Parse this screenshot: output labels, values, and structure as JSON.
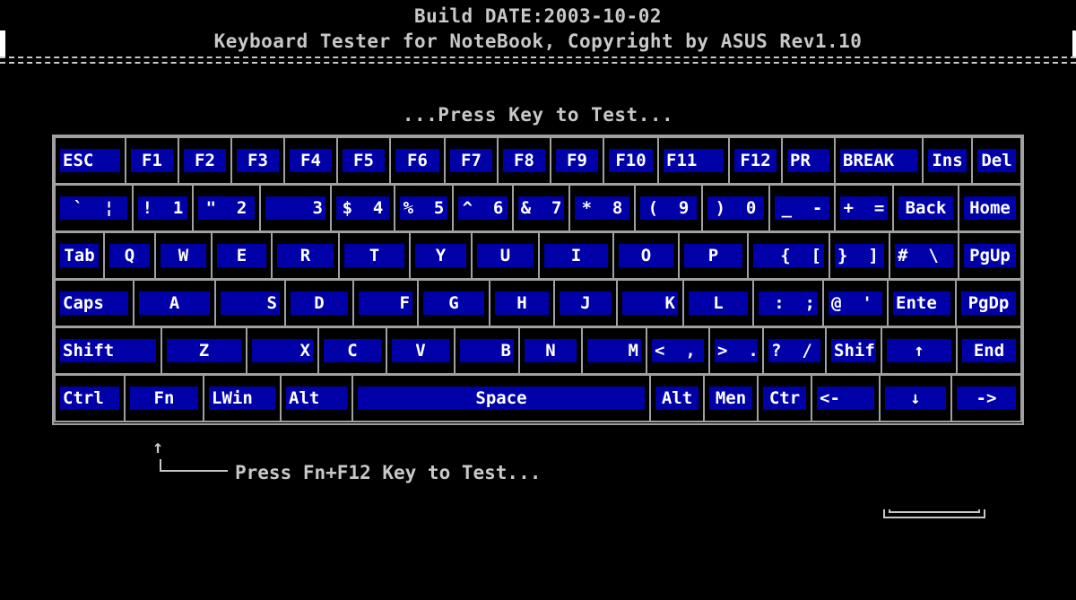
{
  "header": {
    "build_line": "Build DATE:2003-10-02",
    "title_line": "Keyboard Tester for NoteBook, Copyright by ASUS Rev1.10"
  },
  "prompt": "...Press Key to Test...",
  "fn_hint": {
    "arrow": "↑",
    "text": "Press Fn+F12 Key to Test..."
  },
  "keyboard": {
    "rows": [
      [
        {
          "label": "ESC",
          "name": "esc"
        },
        {
          "label": "F1",
          "name": "f1"
        },
        {
          "label": "F2",
          "name": "f2"
        },
        {
          "label": "F3",
          "name": "f3"
        },
        {
          "label": "F4",
          "name": "f4"
        },
        {
          "label": "F5",
          "name": "f5"
        },
        {
          "label": "F6",
          "name": "f6"
        },
        {
          "label": "F7",
          "name": "f7"
        },
        {
          "label": "F8",
          "name": "f8"
        },
        {
          "label": "F9",
          "name": "f9"
        },
        {
          "label": "F10",
          "name": "f10"
        },
        {
          "label": "F11",
          "name": "f11"
        },
        {
          "label": "F12",
          "name": "f12"
        },
        {
          "label": "PR",
          "name": "pr"
        },
        {
          "label": "BREAK",
          "name": "break"
        },
        {
          "label": "Ins",
          "name": "ins"
        },
        {
          "label": "Del",
          "name": "del"
        }
      ],
      [
        {
          "label": "`  ¦",
          "name": "backtick"
        },
        {
          "label": "!  1",
          "name": "1"
        },
        {
          "label": "\"  2",
          "name": "2"
        },
        {
          "label": "   3",
          "name": "3"
        },
        {
          "label": "$  4",
          "name": "4"
        },
        {
          "label": "%  5",
          "name": "5"
        },
        {
          "label": "^  6",
          "name": "6"
        },
        {
          "label": "&  7",
          "name": "7"
        },
        {
          "label": "*  8",
          "name": "8"
        },
        {
          "label": "(  9",
          "name": "9"
        },
        {
          "label": ")  0",
          "name": "0"
        },
        {
          "label": "_  -",
          "name": "minus"
        },
        {
          "label": "+  =",
          "name": "equals"
        },
        {
          "label": "Back",
          "name": "backspace"
        },
        {
          "label": "Home",
          "name": "home"
        }
      ],
      [
        {
          "label": "Tab",
          "name": "tab"
        },
        {
          "label": "Q",
          "name": "q"
        },
        {
          "label": "W",
          "name": "w"
        },
        {
          "label": "E",
          "name": "e"
        },
        {
          "label": "R",
          "name": "r"
        },
        {
          "label": "T",
          "name": "t"
        },
        {
          "label": "Y",
          "name": "y"
        },
        {
          "label": "U",
          "name": "u"
        },
        {
          "label": "I",
          "name": "i"
        },
        {
          "label": "O",
          "name": "o"
        },
        {
          "label": "P",
          "name": "p"
        },
        {
          "label": "{  [",
          "name": "lbracket"
        },
        {
          "label": "}  ]",
          "name": "rbracket"
        },
        {
          "label": "#  \\",
          "name": "backslash"
        },
        {
          "label": "PgUp",
          "name": "pgup"
        }
      ],
      [
        {
          "label": "Caps",
          "name": "caps"
        },
        {
          "label": "A",
          "name": "a"
        },
        {
          "label": "S",
          "name": "s"
        },
        {
          "label": "D",
          "name": "d"
        },
        {
          "label": "F",
          "name": "f"
        },
        {
          "label": "G",
          "name": "g"
        },
        {
          "label": "H",
          "name": "h"
        },
        {
          "label": "J",
          "name": "j"
        },
        {
          "label": "K",
          "name": "k"
        },
        {
          "label": "L",
          "name": "l"
        },
        {
          "label": ":  ;",
          "name": "semicolon"
        },
        {
          "label": "@  '",
          "name": "quote"
        },
        {
          "label": "Ente",
          "name": "enter"
        },
        {
          "label": "PgDp",
          "name": "pgdn"
        }
      ],
      [
        {
          "label": "Shift",
          "name": "lshift"
        },
        {
          "label": "Z",
          "name": "z"
        },
        {
          "label": "X",
          "name": "x"
        },
        {
          "label": "C",
          "name": "c"
        },
        {
          "label": "V",
          "name": "v"
        },
        {
          "label": "B",
          "name": "b"
        },
        {
          "label": "N",
          "name": "n"
        },
        {
          "label": "M",
          "name": "m"
        },
        {
          "label": "<  ,",
          "name": "comma"
        },
        {
          "label": ">  .",
          "name": "period"
        },
        {
          "label": "?  /",
          "name": "slash"
        },
        {
          "label": "Shif",
          "name": "rshift"
        },
        {
          "label": "↑",
          "name": "up"
        },
        {
          "label": "End",
          "name": "end"
        }
      ],
      [
        {
          "label": "Ctrl",
          "name": "lctrl"
        },
        {
          "label": "Fn",
          "name": "fn"
        },
        {
          "label": "LWin",
          "name": "lwin"
        },
        {
          "label": "Alt",
          "name": "lalt"
        },
        {
          "label": "Space",
          "name": "space"
        },
        {
          "label": "Alt",
          "name": "ralt"
        },
        {
          "label": "Men",
          "name": "menu"
        },
        {
          "label": "Ctr",
          "name": "rctrl"
        },
        {
          "label": "<-",
          "name": "left"
        },
        {
          "label": "↓",
          "name": "down"
        },
        {
          "label": "->",
          "name": "right"
        }
      ]
    ]
  },
  "colors": {
    "background": "#000000",
    "key_face": "#0000a8",
    "key_text": "#ffffff",
    "text": "#c8c8c8",
    "grid": "#a0a0a0"
  }
}
